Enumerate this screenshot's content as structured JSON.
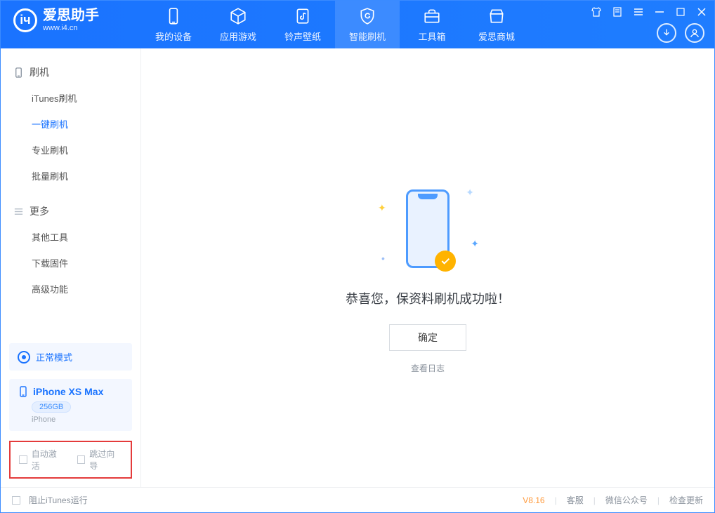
{
  "brand": {
    "cn": "爱思助手",
    "url": "www.i4.cn"
  },
  "tabs": [
    {
      "label": "我的设备"
    },
    {
      "label": "应用游戏"
    },
    {
      "label": "铃声壁纸"
    },
    {
      "label": "智能刷机"
    },
    {
      "label": "工具箱"
    },
    {
      "label": "爱思商城"
    }
  ],
  "sidebar": {
    "group1": "刷机",
    "items1": [
      "iTunes刷机",
      "一键刷机",
      "专业刷机",
      "批量刷机"
    ],
    "group2": "更多",
    "items2": [
      "其他工具",
      "下载固件",
      "高级功能"
    ]
  },
  "mode": "正常模式",
  "device": {
    "name": "iPhone XS Max",
    "capacity": "256GB",
    "type": "iPhone"
  },
  "opts": {
    "auto": "自动激活",
    "skip": "跳过向导"
  },
  "main": {
    "success": "恭喜您，保资料刷机成功啦！",
    "ok": "确定",
    "log": "查看日志"
  },
  "footer": {
    "block": "阻止iTunes运行",
    "ver": "V8.16",
    "kefu": "客服",
    "wx": "微信公众号",
    "upd": "检查更新"
  }
}
